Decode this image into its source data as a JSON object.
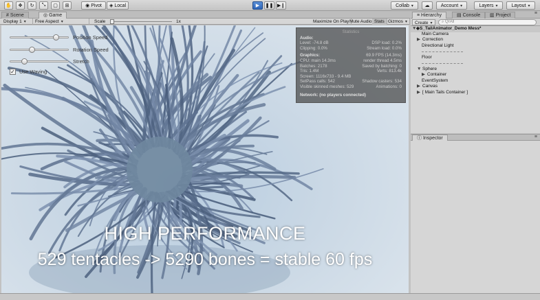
{
  "toolbar": {
    "tools": [
      "hand-tool",
      "move-tool",
      "rotate-tool",
      "scale-tool",
      "rect-tool",
      "transform-tool"
    ],
    "pivot_label": "Pivot",
    "local_label": "Local",
    "collab_label": "Collab",
    "account_label": "Account",
    "layers_label": "Layers",
    "layout_label": "Layout"
  },
  "scene_tabs": [
    {
      "label": "Scene"
    },
    {
      "label": "Game"
    }
  ],
  "gamebar": {
    "display": "Display 1",
    "aspect": "Free Aspect",
    "scale_label": "Scale",
    "scale_value": "1x",
    "maximize": "Maximize On Play",
    "mute": "Mute Audio",
    "stats": "Stats",
    "gizmos": "Gizmos"
  },
  "viewport_ui": {
    "sliders": [
      {
        "label": "Position Speed",
        "value": 0.8
      },
      {
        "label": "Rotation Speed",
        "value": 0.35
      },
      {
        "label": "Stretch",
        "value": 0.2
      }
    ],
    "toggle": {
      "label": "Use Waving",
      "checked": true
    }
  },
  "stats": {
    "title": "Statistics",
    "audio_header": "Audio:",
    "audio_rows": [
      [
        "Level: -74.8 dB",
        "DSP load: 0.2%"
      ],
      [
        "Clipping: 0.0%",
        "Stream load: 0.0%"
      ]
    ],
    "graphics_header": "Graphics:",
    "fps": "69.9 FPS (14.3ms)",
    "graphics_rows": [
      [
        "CPU: main 14.3ms",
        "render thread 4.5ms"
      ],
      [
        "Batches: 2178",
        "Saved by batching: 0"
      ],
      [
        "Tris: 1.4M",
        "Verts: 813.4k"
      ],
      [
        "Screen: 1116x733 - 9.4 MB",
        ""
      ],
      [
        "SetPass calls: 542",
        "Shadow casters: 534"
      ],
      [
        "Visible skinned meshes: 529",
        "Animations: 0"
      ]
    ],
    "network": "Network: (no players connected)"
  },
  "overlay": {
    "line1": "HIGH PERFORMANCE",
    "line2": "529 tentacles -> 5290 bones = stable 60 fps"
  },
  "hierarchy": {
    "tab_label": "Hierarchy",
    "console_label": "Console",
    "project_label": "Project",
    "create_label": "Create",
    "search_placeholder": "QrAll",
    "rows": [
      {
        "label": "S_TailAnimator_Demo Mess*",
        "indent": 0,
        "caret": "▼",
        "root": true
      },
      {
        "label": "Main Camera",
        "indent": 1,
        "caret": ""
      },
      {
        "label": "Correction",
        "indent": 1,
        "caret": "▶"
      },
      {
        "label": "Directional Light",
        "indent": 1,
        "caret": ""
      },
      {
        "label": "",
        "indent": 1,
        "caret": "",
        "sep": true
      },
      {
        "label": "Floor",
        "indent": 1,
        "caret": ""
      },
      {
        "label": "",
        "indent": 1,
        "caret": "",
        "sep": true
      },
      {
        "label": "Sphere",
        "indent": 1,
        "caret": "▼"
      },
      {
        "label": "Container",
        "indent": 2,
        "caret": "▶"
      },
      {
        "label": "EventSystem",
        "indent": 1,
        "caret": ""
      },
      {
        "label": "Canvas",
        "indent": 1,
        "caret": "▶"
      },
      {
        "label": "[ Main Tails Container ]",
        "indent": 1,
        "caret": "▶"
      }
    ]
  },
  "inspector": {
    "tab_label": "Inspector"
  }
}
